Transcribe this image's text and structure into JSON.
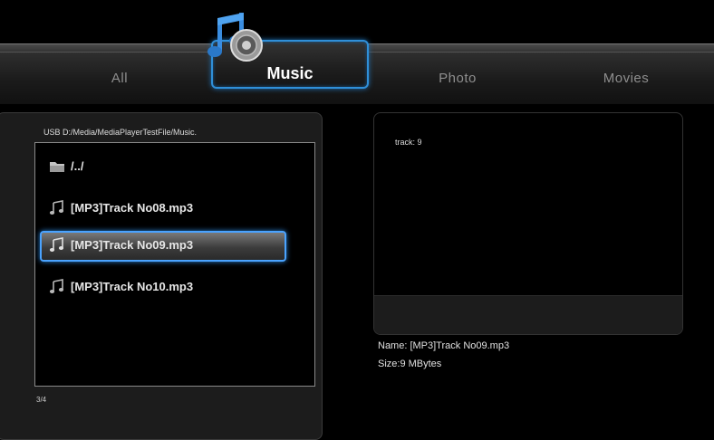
{
  "tabs": {
    "all": "All",
    "music": "Music",
    "photo": "Photo",
    "movies": "Movies",
    "active": "music"
  },
  "browser": {
    "path": "USB D:/Media/MediaPlayerTestFile/Music.",
    "items": [
      {
        "icon": "folder-icon",
        "label": "/../"
      },
      {
        "icon": "music-note-icon",
        "label": "[MP3]Track No08.mp3"
      },
      {
        "icon": "music-note-icon",
        "label": "[MP3]Track No09.mp3",
        "selected": true
      },
      {
        "icon": "music-note-icon",
        "label": "[MP3]Track No10.mp3"
      }
    ],
    "counter": "3/4"
  },
  "info": {
    "track": "track: 9",
    "name": "Name: [MP3]Track No09.mp3",
    "size": "Size:9 MBytes"
  },
  "colors": {
    "accent": "#2f8fd8",
    "background": "#000000"
  }
}
